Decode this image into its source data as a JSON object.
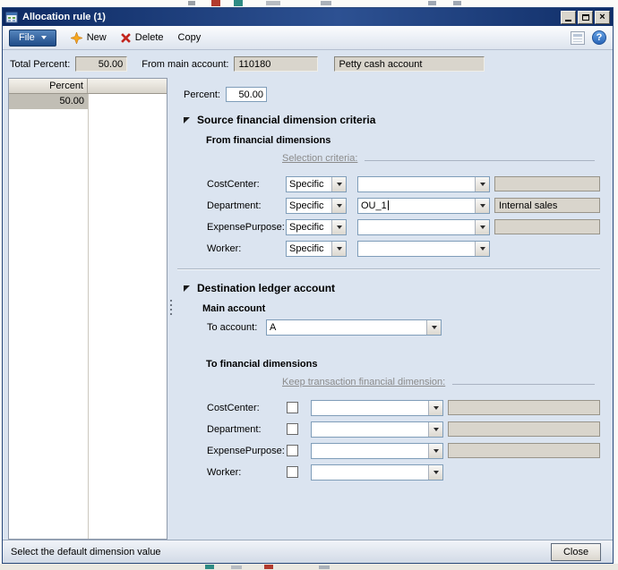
{
  "titlebar": {
    "title": "Allocation rule (1)"
  },
  "toolbar": {
    "file_label": "File",
    "new_label": "New",
    "delete_label": "Delete",
    "copy_label": "Copy"
  },
  "header": {
    "total_percent_label": "Total Percent:",
    "total_percent_value": "50.00",
    "from_main_account_label": "From main account:",
    "from_main_account_value": "110180",
    "main_account_name": "Petty cash account"
  },
  "grid": {
    "percent_header": "Percent",
    "selected_row_percent": "50.00"
  },
  "form": {
    "percent_label": "Percent:",
    "percent_value": "50.00",
    "source": {
      "title": "Source financial dimension criteria",
      "from_dimensions_label": "From financial dimensions",
      "selection_criteria_label": "Selection criteria:",
      "rows": [
        {
          "label": "CostCenter:",
          "criteria": "Specific",
          "value": "",
          "name": ""
        },
        {
          "label": "Department:",
          "criteria": "Specific",
          "value": "OU_1",
          "name": "Internal sales"
        },
        {
          "label": "ExpensePurpose:",
          "criteria": "Specific",
          "value": "",
          "name": ""
        },
        {
          "label": "Worker:",
          "criteria": "Specific",
          "value": ""
        }
      ]
    },
    "destination": {
      "title": "Destination ledger account",
      "main_account_label": "Main account",
      "to_account_label": "To account:",
      "to_account_value": "A",
      "to_dimensions_label": "To financial dimensions",
      "keep_transaction_label": "Keep transaction financial dimension:",
      "rows": [
        {
          "label": "CostCenter:",
          "checked": false,
          "value": "",
          "name": ""
        },
        {
          "label": "Department:",
          "checked": false,
          "value": "",
          "name": ""
        },
        {
          "label": "ExpensePurpose:",
          "checked": false,
          "value": "",
          "name": ""
        },
        {
          "label": "Worker:",
          "checked": false,
          "value": ""
        }
      ]
    }
  },
  "statusbar": {
    "message": "Select the default dimension value",
    "close_label": "Close"
  }
}
